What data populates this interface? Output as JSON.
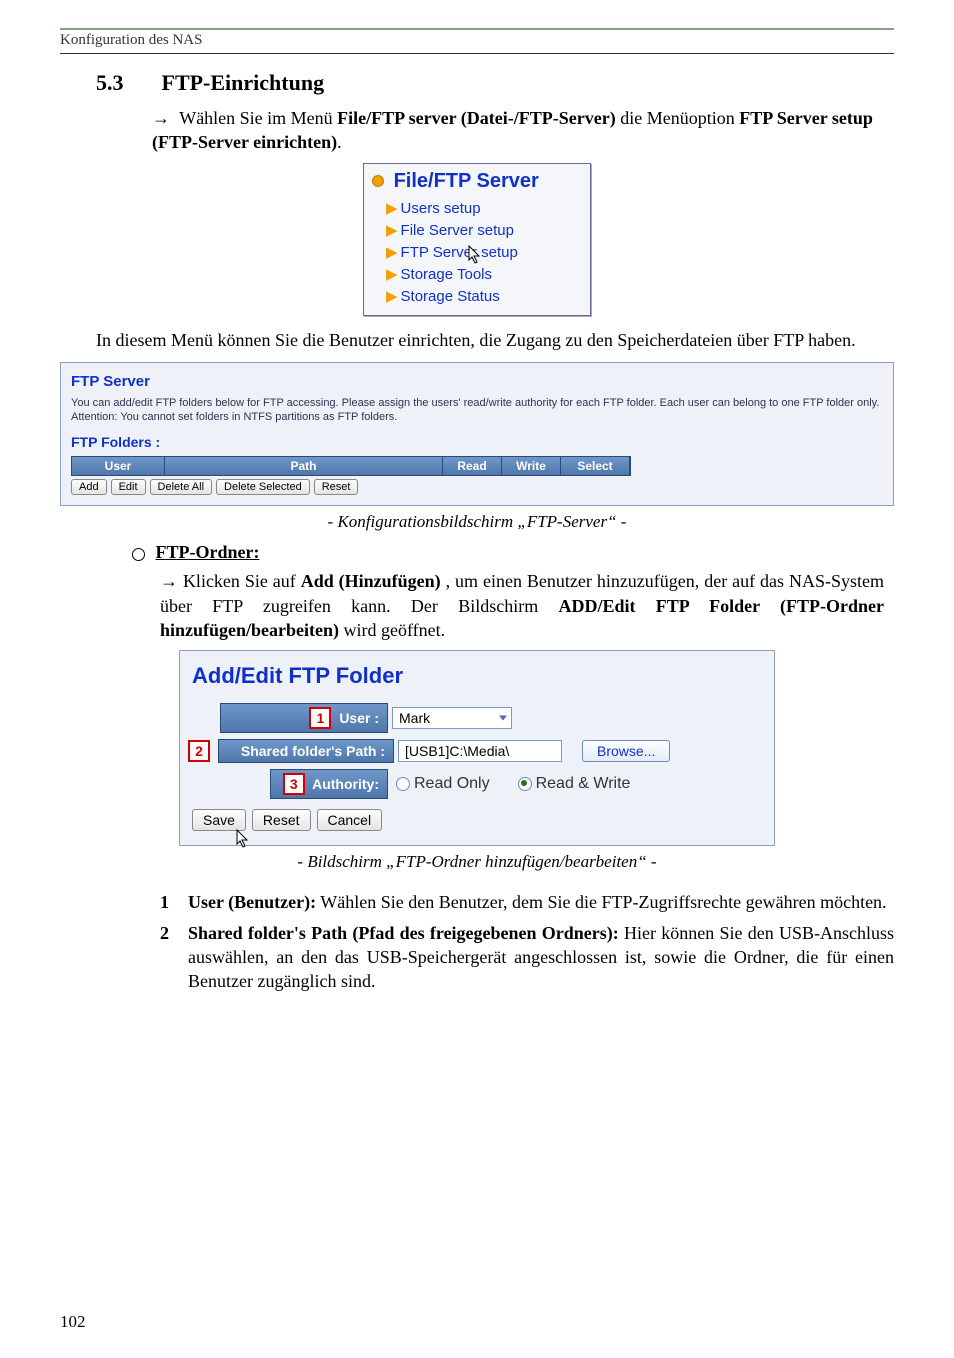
{
  "header_region": "Konfiguration des NAS",
  "section_number": "5.3",
  "section_title": "FTP-Einrichtung",
  "intro_prefix": "Wählen Sie im Menü ",
  "intro_bold1": "File/FTP server (Datei-/FTP-Server)",
  "intro_mid": " die Menüoption ",
  "intro_bold2": "FTP Server setup (FTP-Server einrichten)",
  "intro_suffix": ".",
  "menu": {
    "title": "File/FTP Server",
    "items": [
      "Users setup",
      "File Server setup",
      "FTP Server setup",
      "Storage Tools",
      "Storage Status"
    ]
  },
  "after_menu_text": "In diesem Menü können Sie die Benutzer einrichten, die Zugang zu den Speicherdateien über FTP haben.",
  "ftpserver": {
    "heading": "FTP Server",
    "desc1": "You can add/edit FTP folders below for FTP accessing. Please assign the users' read/write authority for each FTP folder. Each user can belong to one FTP folder only.",
    "desc2": "Attention: You cannot set folders in NTFS partitions as FTP folders.",
    "sub": "FTP Folders  :",
    "th": {
      "user": "User",
      "path": "Path",
      "read": "Read",
      "write": "Write",
      "select": "Select"
    },
    "buttons": {
      "add": "Add",
      "edit": "Edit",
      "delall": "Delete All",
      "delsel": "Delete Selected",
      "reset": "Reset"
    }
  },
  "caption1": "- Konfigurationsbildschirm „FTP-Server“ -",
  "ftp_ordner_title": "FTP-Ordner:",
  "add_para_prefix": "Klicken Sie auf ",
  "add_para_bold1": "Add (Hinzufügen)",
  "add_para_mid1": ", um einen Benutzer hinzuzufügen, der auf das NAS-System über FTP zugreifen kann. Der Bildschirm  ",
  "add_para_bold2": "ADD/Edit FTP Folder (FTP-Ordner hinzufügen/bearbeiten)",
  "add_para_suffix": " wird geöffnet.",
  "addedit": {
    "title": "Add/Edit FTP Folder",
    "labels": {
      "user": "User :",
      "path": "Shared folder's Path :",
      "authority": "Authority:"
    },
    "values": {
      "user_selected": "Mark",
      "path_value": "[USB1]C:\\Media\\"
    },
    "browse": "Browse...",
    "radios": {
      "readonly": "Read Only",
      "readwrite": "Read & Write"
    },
    "buttons": {
      "save": "Save",
      "reset": "Reset",
      "cancel": "Cancel"
    }
  },
  "caption2": "- Bildschirm „FTP-Ordner hinzufügen/bearbeiten“ -",
  "numlist": [
    {
      "lead": "User (Benutzer):",
      "text": " Wählen Sie den Benutzer, dem Sie die FTP-Zugriffsrechte gewähren möchten."
    },
    {
      "lead": "Shared folder's Path (Pfad des freigegebenen Ordners):",
      "text": " Hier können Sie den USB-Anschluss auswählen, an den das USB-Speichergerät angeschlossen ist, sowie die Ordner, die für einen Benutzer zugänglich sind."
    }
  ],
  "page_number": "102"
}
